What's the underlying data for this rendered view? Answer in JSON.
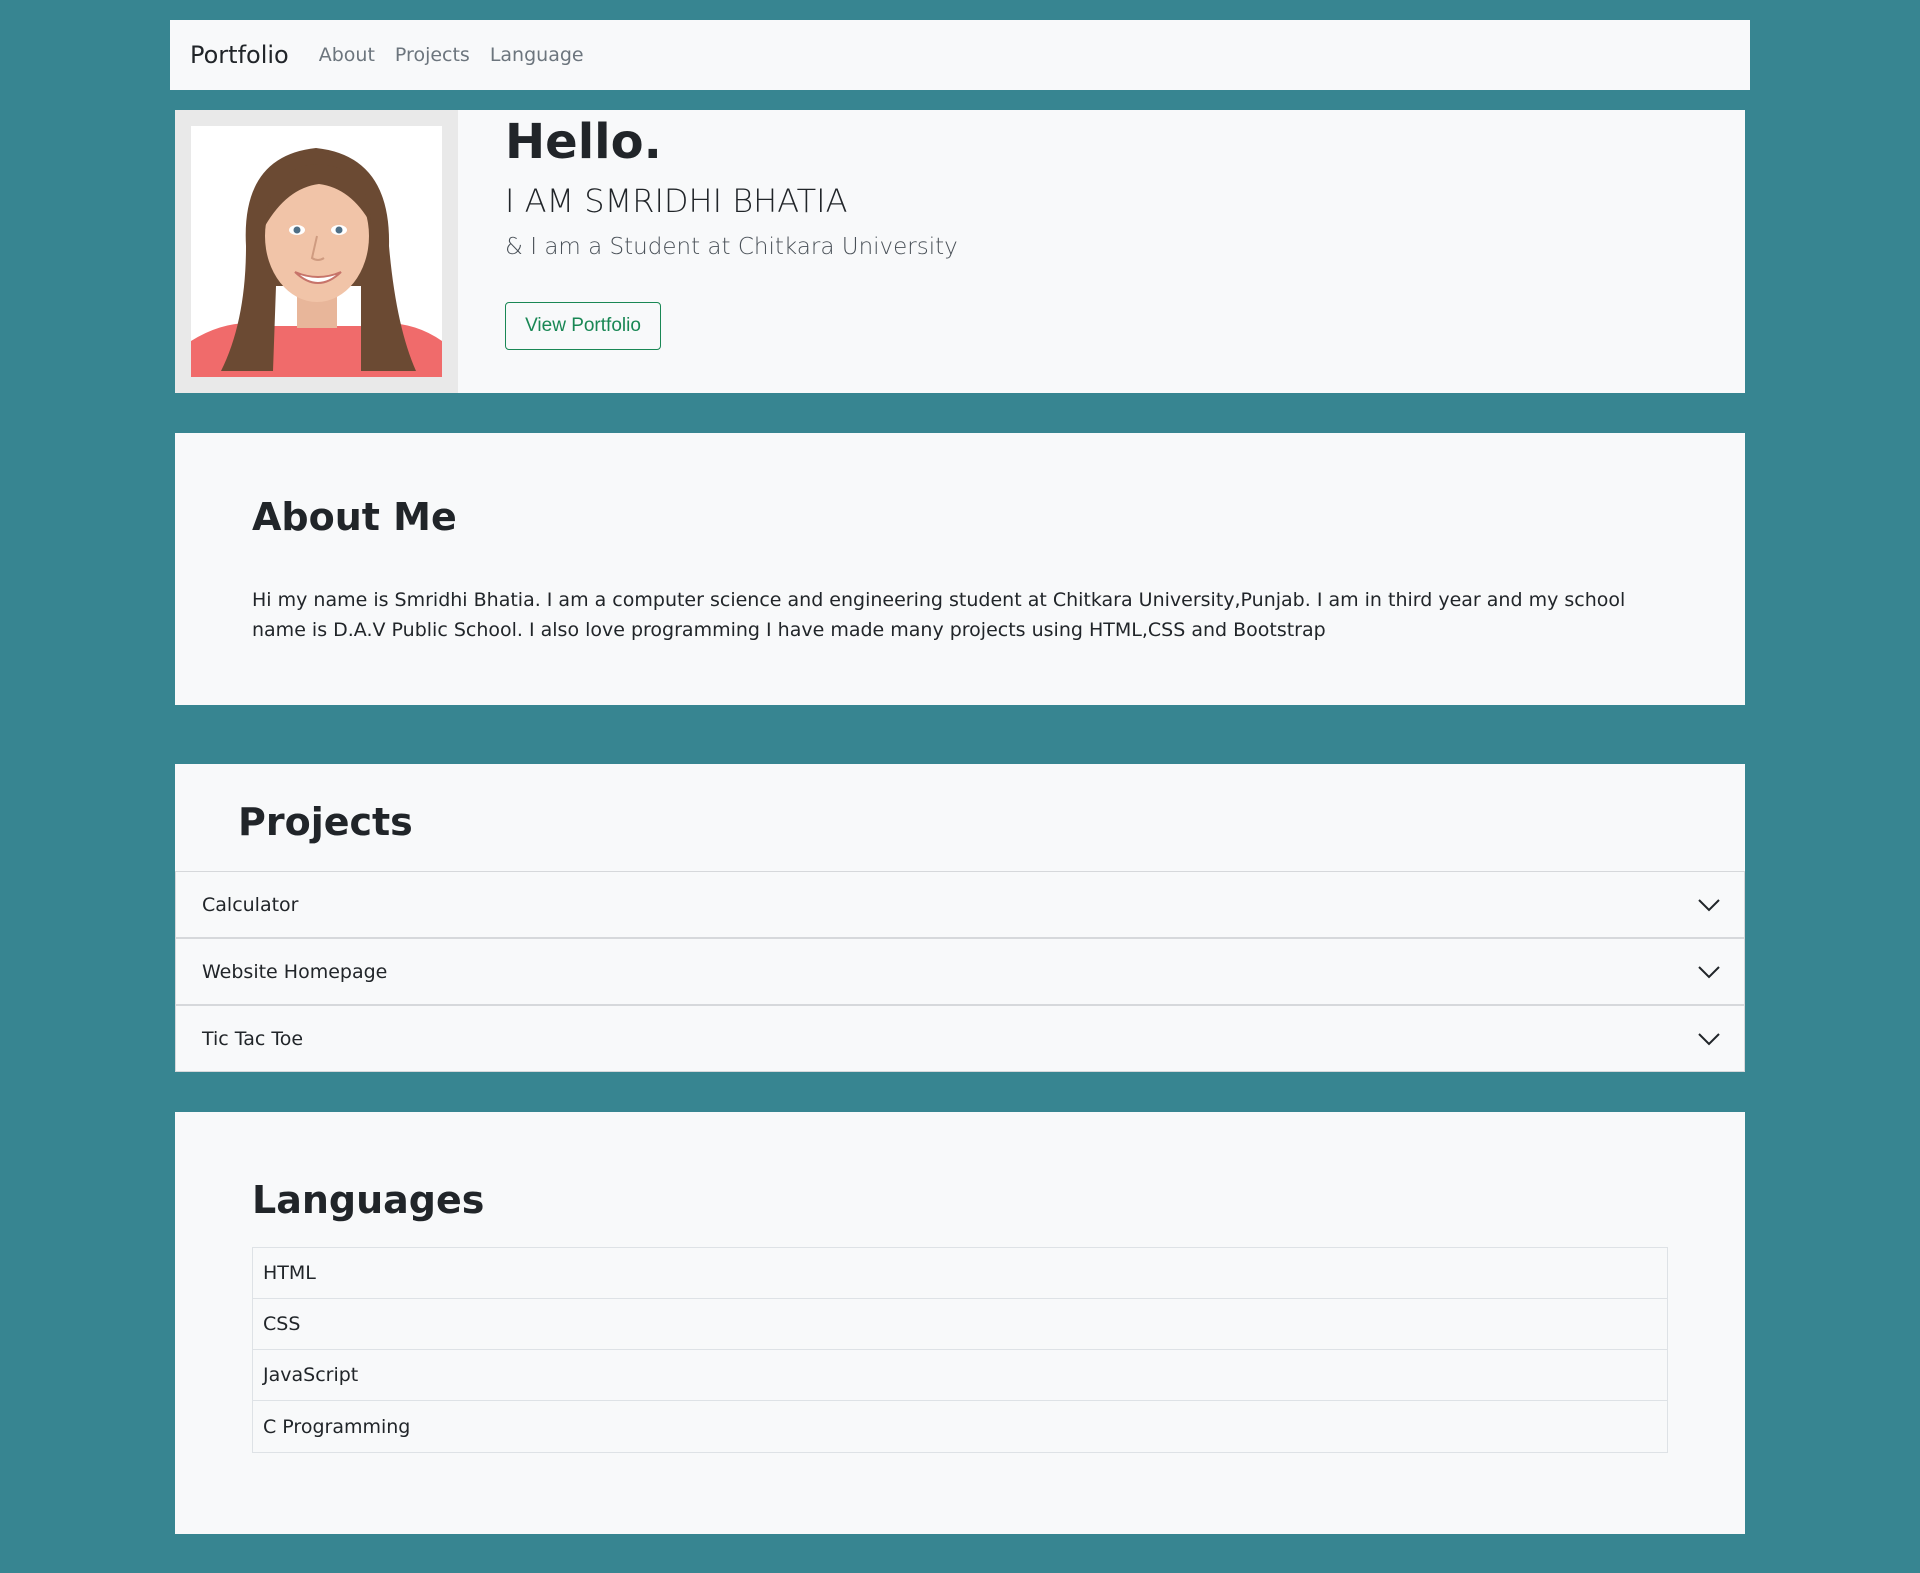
{
  "navbar": {
    "brand": "Portfolio",
    "links": [
      "About",
      "Projects",
      "Language"
    ]
  },
  "hero": {
    "greeting": "Hello.",
    "name_line": "I AM SMRIDHI BHATIA",
    "tagline": "& I am a Student at Chitkara University",
    "button_label": "View Portfolio"
  },
  "about": {
    "heading": "About Me",
    "text": "Hi my name is Smridhi Bhatia. I am a computer science and engineering student at Chitkara University,Punjab. I am in third year and my school name is D.A.V Public School. I also love programming I have made many projects using HTML,CSS and Bootstrap"
  },
  "projects": {
    "heading": "Projects",
    "items": [
      "Calculator",
      "Website Homepage",
      "Tic Tac Toe"
    ]
  },
  "languages": {
    "heading": "Languages",
    "items": [
      "HTML",
      "CSS",
      "JavaScript",
      "C Programming"
    ]
  },
  "colors": {
    "background": "#378591",
    "panel": "#f8f9fa",
    "button_accent": "#198754"
  },
  "icons": {
    "accordion_toggle": "chevron-down-icon"
  }
}
